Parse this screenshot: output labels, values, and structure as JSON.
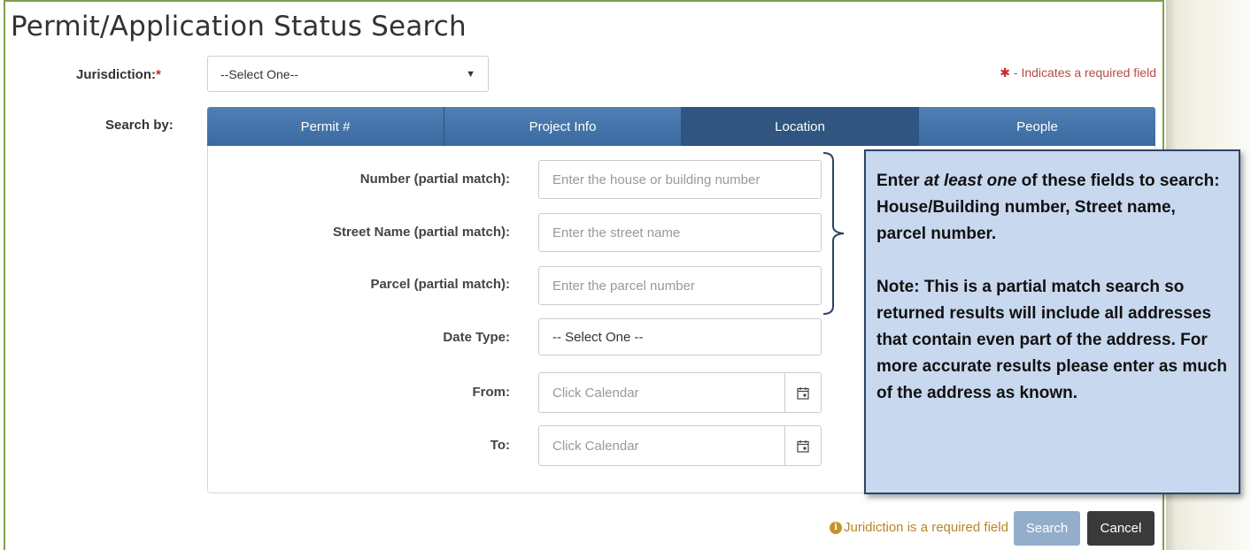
{
  "page": {
    "title": "Permit/Application Status Search"
  },
  "jurisdiction": {
    "label": "Jurisdiction:",
    "required_mark": "*",
    "selected": "--Select One--"
  },
  "required_note": {
    "star": "✱",
    "text": " - Indicates a required field"
  },
  "search_by": {
    "label": "Search by:",
    "tabs": [
      {
        "label": "Permit #",
        "active": false
      },
      {
        "label": "Project Info",
        "active": false
      },
      {
        "label": "Location",
        "active": true
      },
      {
        "label": "People",
        "active": false
      }
    ]
  },
  "location_form": {
    "number": {
      "label": "Number (partial match):",
      "placeholder": "Enter the house or building number"
    },
    "street": {
      "label": "Street Name (partial match):",
      "placeholder": "Enter the street name"
    },
    "parcel": {
      "label": "Parcel (partial match):",
      "placeholder": "Enter the parcel number"
    },
    "date_type": {
      "label": "Date Type:",
      "selected": "-- Select One --"
    },
    "from": {
      "label": "From:",
      "placeholder": "Click Calendar",
      "icon": "calendar-icon"
    },
    "to": {
      "label": "To:",
      "placeholder": "Click Calendar",
      "icon": "calendar-icon"
    }
  },
  "callout": {
    "line1_pre": "Enter ",
    "line1_em": "at least one",
    "line1_post": " of these fields to search: House/Building number, Street name, parcel number.",
    "line2": "Note: This is a partial match search so returned results will include all addresses that contain even part of the address. For more accurate results please enter as much of the address as known."
  },
  "footer": {
    "info_icon": "info-icon",
    "info_glyph": "i",
    "validation_message": "Juridiction is a required field",
    "search_label": "Search",
    "cancel_label": "Cancel"
  },
  "colors": {
    "frame_border": "#7fa04b",
    "tab_blue": "#3a6aa0",
    "tab_active": "#2f5580",
    "callout_bg": "#c8d8ee",
    "required_red": "#c62b2b",
    "warning_gold": "#b7862a"
  }
}
